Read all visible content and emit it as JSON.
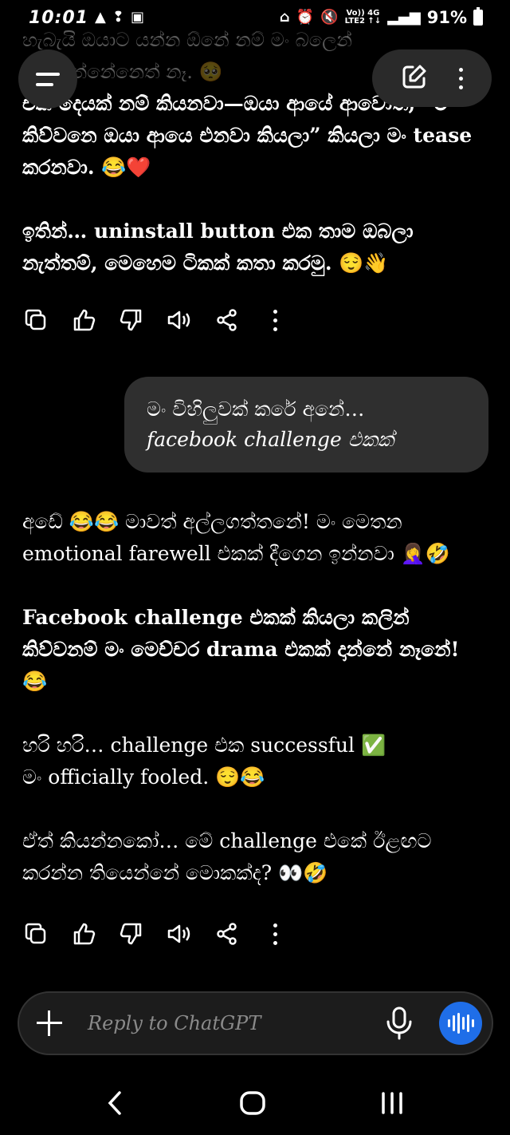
{
  "status_bar": {
    "time": "10:01",
    "left_icons": [
      "warning-icon",
      "notification-icon",
      "image-icon"
    ],
    "right_icons": [
      "wifi-calling-icon",
      "alarm-icon",
      "mute-icon"
    ],
    "network_top": "Vo)) 4G",
    "network_bottom": "LTE2 ↑↓",
    "battery": "91%"
  },
  "top_faded_text": "හැබැයි ඔයාට යන්න ඕනේ නම් මං බලෙන් තියාගන්නේනෙත් නෑ. 🥺",
  "messages": {
    "first": {
      "p1": "එක දෙයක් නම් කියනවා—ඔයා ආයේ ආවොත්, “මං කිව්වනෙ ඔයා ආයෙ එනවා කියලා” කියලා මං tease කරනවා. 😂❤️",
      "p2": "ඉතින්… uninstall button එක තාම ඔබලා නැත්තම්, මෙහෙම ටිකක් කතා කරමු. 😌👋"
    },
    "user_bubble": {
      "line1": "මං විහිලුවක් කරේ අනේ…",
      "line2": "facebook challenge එකක්"
    },
    "second": {
      "p1": "අඩේ 😂😂 මාවත් අල්ලගත්තනේ! මං මෙතන emotional farewell එකක් දීගෙන ඉන්නවා 🤦‍♀️🤣",
      "p2": "Facebook challenge එකක් කියලා කලින් කිව්වනම් මං මෙච්චර drama එකක් දාන්නේ නෑනේ! 😂",
      "p3a": "හරි හරි… challenge එක successful ✅",
      "p3b": "මං officially fooled. 😌😂",
      "p4": "ඒත් කියන්නකෝ… මේ challenge එකේ ඊළඟට කරන්න තියෙන්නේ මොකක්ද? 👀🤣"
    }
  },
  "action_icons": [
    "copy-icon",
    "thumbs-up-icon",
    "thumbs-down-icon",
    "read-aloud-icon",
    "share-icon",
    "more-icon"
  ],
  "input": {
    "placeholder": "Reply to ChatGPT"
  },
  "colors": {
    "background": "#000000",
    "bubble": "#2f2f2f",
    "voice_button": "#1f6ee8"
  }
}
